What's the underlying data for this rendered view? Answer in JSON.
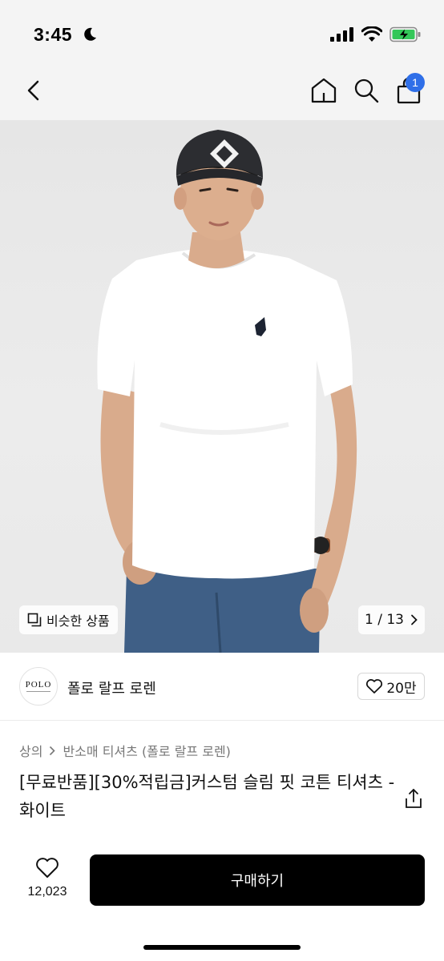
{
  "status_bar": {
    "time": "3:45"
  },
  "header": {
    "cart_count": "1"
  },
  "hero": {
    "similar_label": "비슷한 상품",
    "page_indicator": "1 / 13"
  },
  "brand": {
    "logo_text": "POLO",
    "name": "폴로 랄프 로렌",
    "likes": "20만"
  },
  "breadcrumb": {
    "category": "상의",
    "subcategory": "반소매 티셔츠 (폴로 랄프 로렌)"
  },
  "product": {
    "title": "[무료반품][30%적립금]커스텀 슬림 핏 코튼 티셔츠 - 화이트"
  },
  "bottom_bar": {
    "wish_count": "12,023",
    "buy_label": "구매하기"
  },
  "colors": {
    "accent_blue": "#2f6fe8",
    "buy_button": "#000000",
    "battery_green": "#34c759"
  }
}
